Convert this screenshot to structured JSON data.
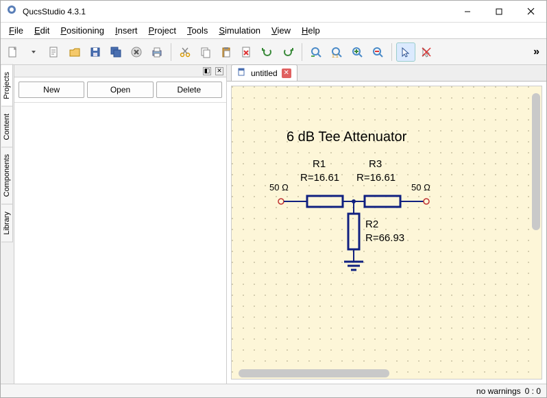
{
  "window": {
    "title": "QucsStudio 4.3.1"
  },
  "menu": {
    "file": "File",
    "edit": "Edit",
    "positioning": "Positioning",
    "insert": "Insert",
    "project": "Project",
    "tools": "Tools",
    "simulation": "Simulation",
    "view": "View",
    "help": "Help"
  },
  "side_tabs": {
    "projects": "Projects",
    "content": "Content",
    "components": "Components",
    "library": "Library"
  },
  "panel_buttons": {
    "new": "New",
    "open": "Open",
    "delete": "Delete"
  },
  "doc_tab": {
    "name": "untitled"
  },
  "schematic": {
    "title": "6 dB Tee Attenuator",
    "port_left": "50 Ω",
    "port_right": "50 Ω",
    "r1_name": "R1",
    "r1_val": "R=16.61",
    "r3_name": "R3",
    "r3_val": "R=16.61",
    "r2_name": "R2",
    "r2_val": "R=66.93"
  },
  "status": {
    "warnings": "no warnings",
    "coords": "0 : 0"
  }
}
